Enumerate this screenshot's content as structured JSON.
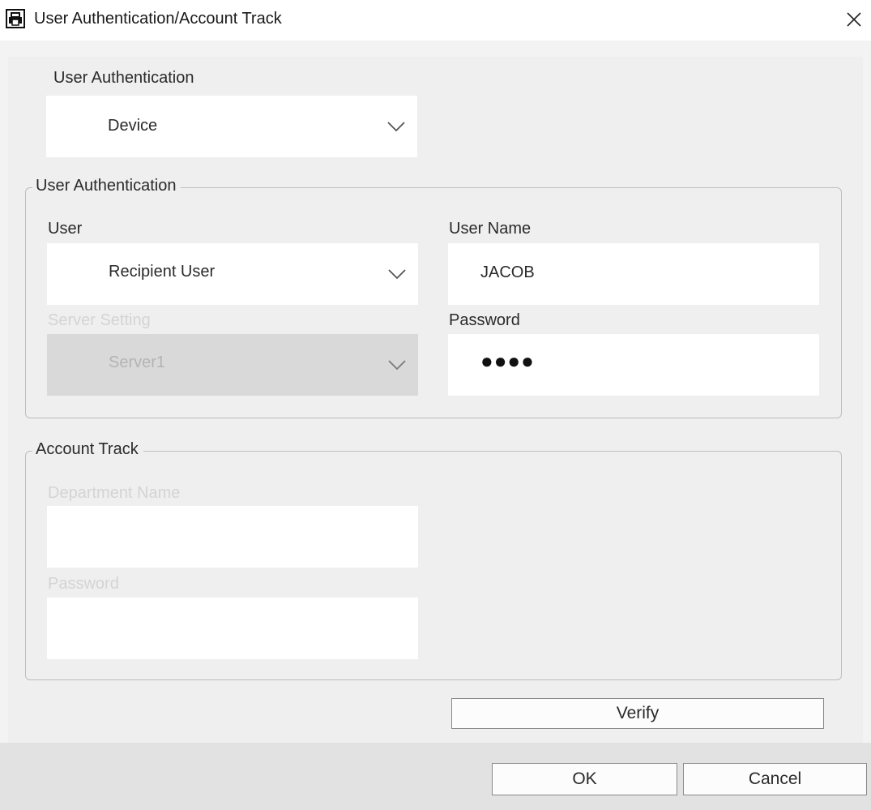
{
  "window": {
    "title": "User Authentication/Account Track",
    "app_icon": "printer-document-icon",
    "close_icon": "close-icon"
  },
  "auth_mode": {
    "label": "User Authentication",
    "value": "Device"
  },
  "user_auth_group": {
    "legend": "User Authentication",
    "user_label": "User",
    "user_value": "Recipient User",
    "server_label": "Server Setting",
    "server_value": "Server1",
    "username_label": "User Name",
    "username_value": "JACOB",
    "password_label": "Password",
    "password_masked": "●●●●"
  },
  "account_track_group": {
    "legend": "Account Track",
    "department_label": "Department Name",
    "department_value": "",
    "password_label": "Password",
    "password_value": ""
  },
  "buttons": {
    "verify": "Verify",
    "ok": "OK",
    "cancel": "Cancel"
  },
  "colors": {
    "window_bg": "#f3f3f3",
    "panel_bg": "#efefef",
    "disabled_field": "#d9d9d9",
    "disabled_text": "#d4d4d4"
  }
}
